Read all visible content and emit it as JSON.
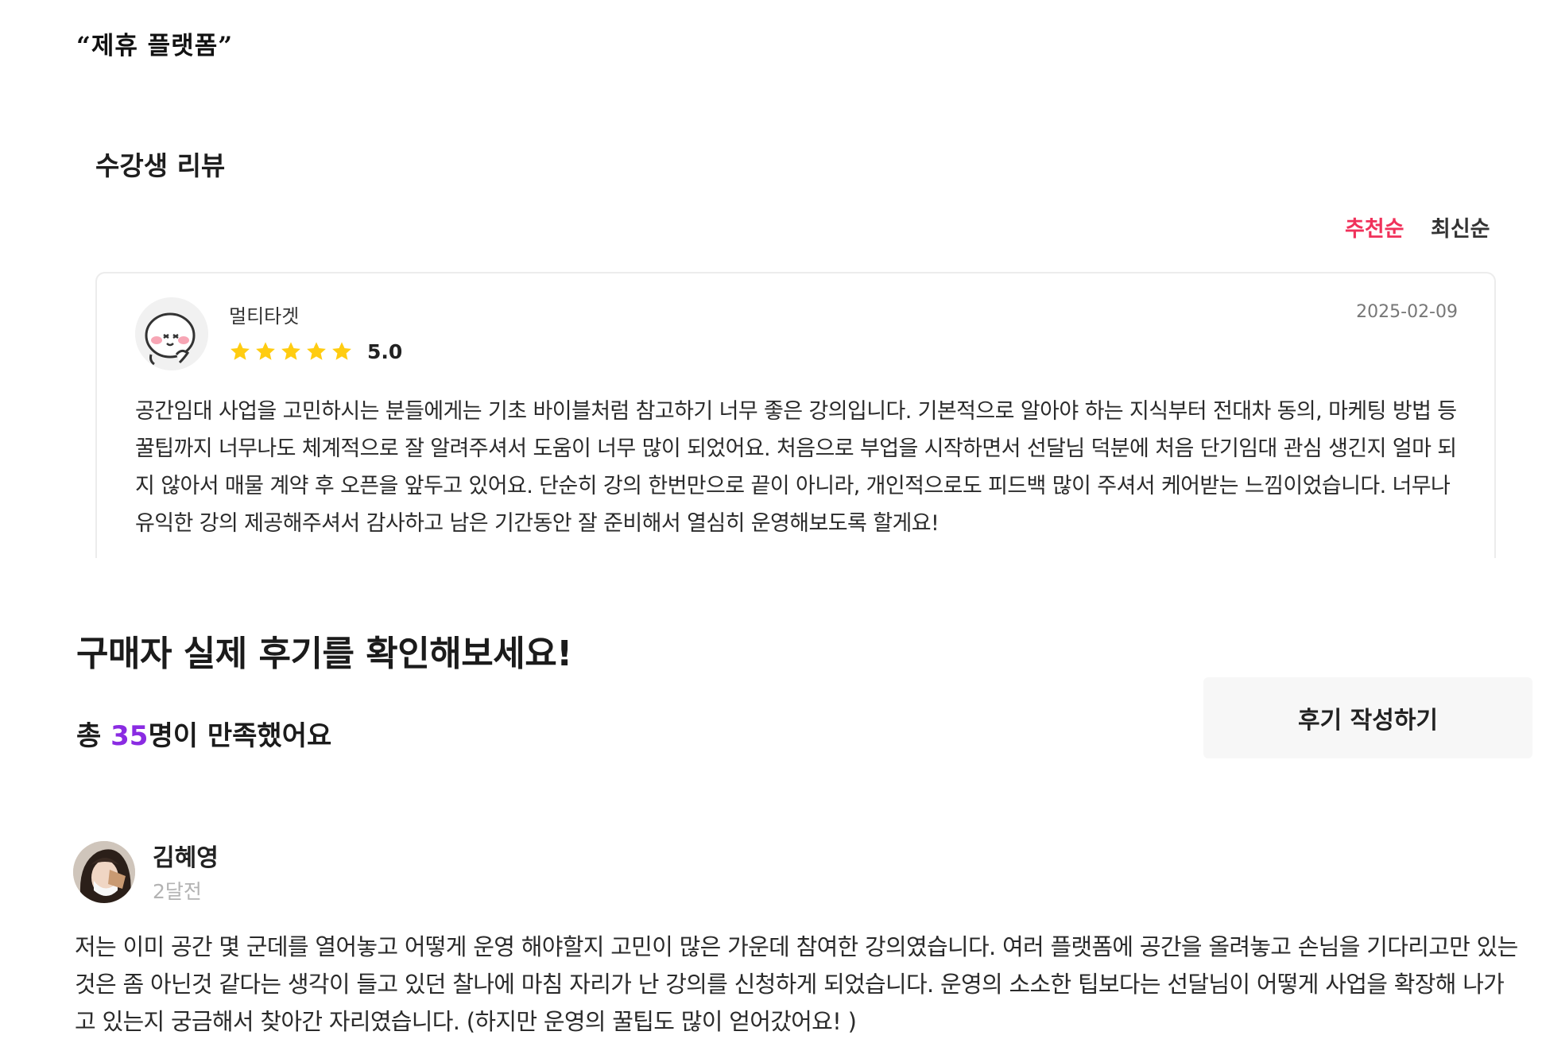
{
  "section_label": "“제휴 플랫폼”",
  "student_reviews": {
    "title": "수강생 리뷰",
    "sort": {
      "recommended": "추천순",
      "latest": "최신순",
      "active_color": "#f0315a"
    },
    "review": {
      "reviewer": "멀티타겟",
      "avatar_icon": "cute-face-avatar-icon",
      "stars": 5,
      "rating": "5.0",
      "date": "2025-02-09",
      "body": "공간임대 사업을 고민하시는 분들에게는 기초 바이블처럼 참고하기 너무 좋은 강의입니다. 기본적으로 알아야 하는 지식부터 전대차 동의, 마케팅 방법 등 꿀팁까지 너무나도 체계적으로 잘 알려주셔서 도움이 너무 많이 되었어요. 처음으로 부업을 시작하면서 선달님 덕분에 처음 단기임대 관심 생긴지 얼마 되지 않아서 매물 계약 후 오픈을 앞두고 있어요. 단순히 강의 한번만으로 끝이 아니라, 개인적으로도 피드백 많이 주셔서 케어받는 느낌이었습니다. 너무나 유익한 강의 제공해주셔서 감사하고 남은 기간동안 잘 준비해서 열심히 운영해보도록 할게요!"
    }
  },
  "buyer_reviews": {
    "heading": "구매자 실제 후기를 확인해보세요!",
    "satisfied_prefix": "총 ",
    "satisfied_count": "35",
    "satisfied_suffix": "명이 만족했어요",
    "count_color": "#8a2be2",
    "write_button": "후기 작성하기",
    "review": {
      "reviewer": "김혜영",
      "time_ago": "2달전",
      "body": "저는 이미 공간 몇 군데를 열어놓고 어떻게 운영 해야할지 고민이 많은 가운데 참여한 강의였습니다. 여러 플랫폼에 공간을 올려놓고 손님을 기다리고만 있는 것은 좀 아닌것 같다는 생각이 들고 있던 찰나에 마침 자리가 난 강의를 신청하게 되었습니다. 운영의 소소한 팁보다는 선달님이 어떻게 사업을 확장해 나가고 있는지 궁금해서 찾아간 자리였습니다. (하지만 운영의 꿀팁도 많이 얻어갔어요! )"
    }
  }
}
